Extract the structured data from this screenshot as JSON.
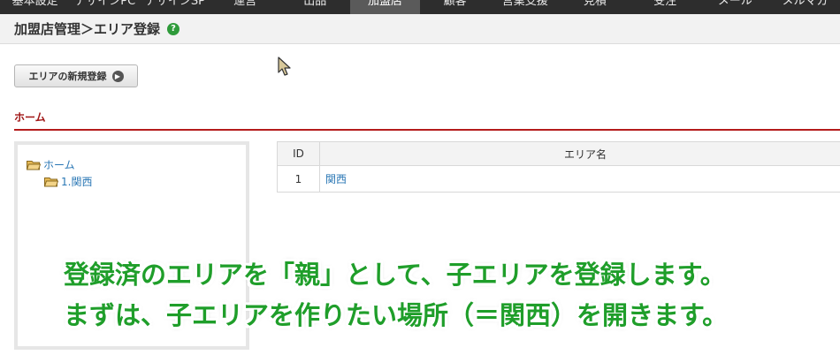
{
  "nav": {
    "items": [
      "基本設定",
      "デザインPC",
      "デザインSP",
      "運営",
      "出品",
      "加盟店",
      "顧客",
      "営業支援",
      "見積",
      "受注",
      "メール",
      "メルマガ"
    ],
    "active_index": 5
  },
  "header": {
    "title": "加盟店管理＞エリア登録",
    "help_icon": "question-circle-icon",
    "help_glyph": "?"
  },
  "toolbar": {
    "new_area_label": "エリアの新規登録",
    "new_area_icon_glyph": "▶"
  },
  "section": {
    "heading": "ホーム"
  },
  "tree": {
    "root_label": "ホーム",
    "child_label": "1.関西"
  },
  "table": {
    "headers": [
      "ID",
      "エリア名"
    ],
    "rows": [
      {
        "id": "1",
        "name": "関西"
      }
    ]
  },
  "caption": {
    "line1": "登録済のエリアを「親」として、子エリアを登録します。",
    "line2": "まずは、子エリアを作りたい場所（＝関西）を開きます。"
  },
  "colors": {
    "accent_red": "#b41c1c",
    "link_blue": "#2a77b5",
    "caption_green": "#1f9e2a",
    "nav_bg": "#2d2d2d",
    "help_green": "#2e9b3a"
  }
}
